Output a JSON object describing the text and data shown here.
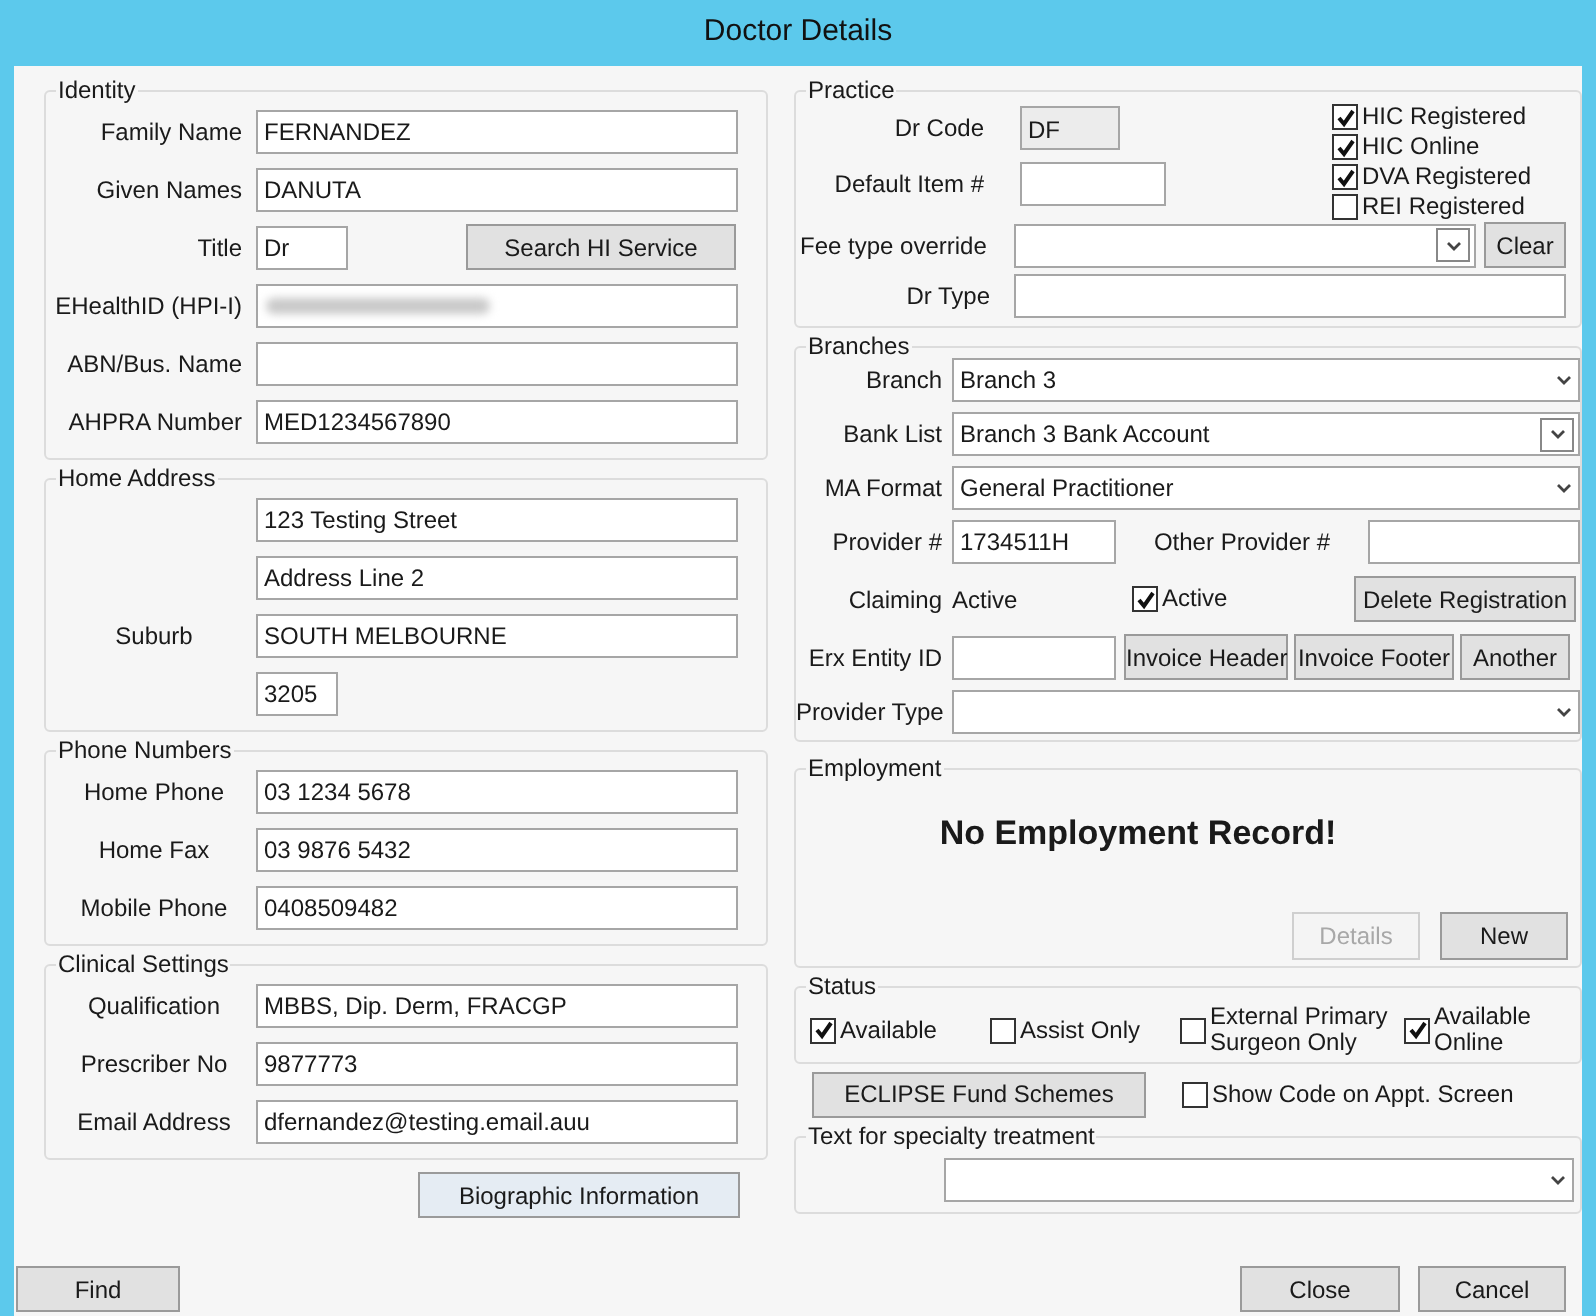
{
  "window": {
    "title": "Doctor Details"
  },
  "left_groups": [
    {
      "legend": "Identity",
      "rows": [
        {
          "kind": "field",
          "label": "Family Name",
          "value": "FERNANDEZ"
        },
        {
          "kind": "field",
          "label": "Given Names",
          "value": "DANUTA"
        },
        {
          "kind": "short_field_button",
          "label": "Title",
          "value": "Dr",
          "button": "Search HI Service"
        },
        {
          "kind": "redacted_field",
          "label": "EHealthID (HPI-I)"
        },
        {
          "kind": "field",
          "label": "ABN/Bus. Name"
        },
        {
          "kind": "field",
          "label": "AHPRA Number",
          "value": "MED1234567890"
        }
      ]
    },
    {
      "legend": "Home Address",
      "rows": [
        {
          "kind": "field",
          "value": "123 Testing Street"
        },
        {
          "kind": "field",
          "value": "Address Line 2"
        },
        {
          "kind": "field",
          "label": "Suburb",
          "value": "SOUTH MELBOURNE"
        },
        {
          "kind": "short_field",
          "value": "3205"
        }
      ]
    },
    {
      "legend": "Phone Numbers",
      "rows": [
        {
          "kind": "field",
          "label": "Home Phone",
          "value": "03 1234 5678"
        },
        {
          "kind": "field",
          "label": "Home Fax",
          "value": "03 9876 5432"
        },
        {
          "kind": "field",
          "label": "Mobile Phone",
          "value": "0408509482"
        }
      ]
    },
    {
      "legend": "Clinical Settings",
      "rows": [
        {
          "kind": "field",
          "label": "Qualification",
          "value": "MBBS, Dip. Derm, FRACGP"
        },
        {
          "kind": "field",
          "label": "Prescriber No",
          "value": "9877773"
        },
        {
          "kind": "field",
          "label": "Email Address",
          "value": "dfernandez@testing.email.auu"
        }
      ]
    }
  ],
  "biographic_button": "Biographic Information",
  "find_button": "Find",
  "practice": {
    "legend": "Practice",
    "dr_code": {
      "label": "Dr Code",
      "value": "DF"
    },
    "default_item": {
      "label": "Default Item #"
    },
    "registrations": [
      {
        "label": "HIC Registered",
        "checked": true
      },
      {
        "label": "HIC Online",
        "checked": true
      },
      {
        "label": "DVA Registered",
        "checked": true
      },
      {
        "label": "REI Registered",
        "checked": false
      }
    ],
    "fee_type": {
      "label": "Fee type override",
      "button": "Clear"
    },
    "dr_type": {
      "label": "Dr Type"
    }
  },
  "branches": {
    "legend": "Branches",
    "branch": {
      "label": "Branch",
      "value": "Branch 3"
    },
    "bank_list": {
      "label": "Bank List",
      "value": "Branch 3 Bank Account"
    },
    "ma_format": {
      "label": "MA Format",
      "value": "General Practitioner"
    },
    "provider": {
      "label": "Provider #",
      "value": "1734511H"
    },
    "other_provider": {
      "label": "Other Provider #"
    },
    "claiming": {
      "label": "Claiming",
      "value": "Active"
    },
    "active": {
      "label": "Active",
      "checked": true
    },
    "delete_button": "Delete Registration",
    "erx": {
      "label": "Erx Entity ID"
    },
    "invoice_buttons": [
      "Invoice Header",
      "Invoice Footer",
      "Another"
    ],
    "provider_type": {
      "label": "Provider Type"
    }
  },
  "employment": {
    "legend": "Employment",
    "message": "No Employment Record!",
    "buttons": [
      {
        "label": "Details",
        "disabled": true
      },
      {
        "label": "New",
        "disabled": false
      }
    ]
  },
  "status": {
    "legend": "Status",
    "options": [
      {
        "label": "Available",
        "checked": true
      },
      {
        "label": "Assist Only",
        "checked": false
      },
      {
        "label": "External Primary Surgeon Only",
        "checked": false
      },
      {
        "label": "Available Online",
        "checked": true
      }
    ]
  },
  "eclipse_button": "ECLIPSE Fund Schemes",
  "show_code": {
    "label": "Show Code on Appt. Screen",
    "checked": false
  },
  "specialty": {
    "legend": "Text for specialty treatment"
  },
  "close_button": "Close",
  "cancel_button": "Cancel"
}
